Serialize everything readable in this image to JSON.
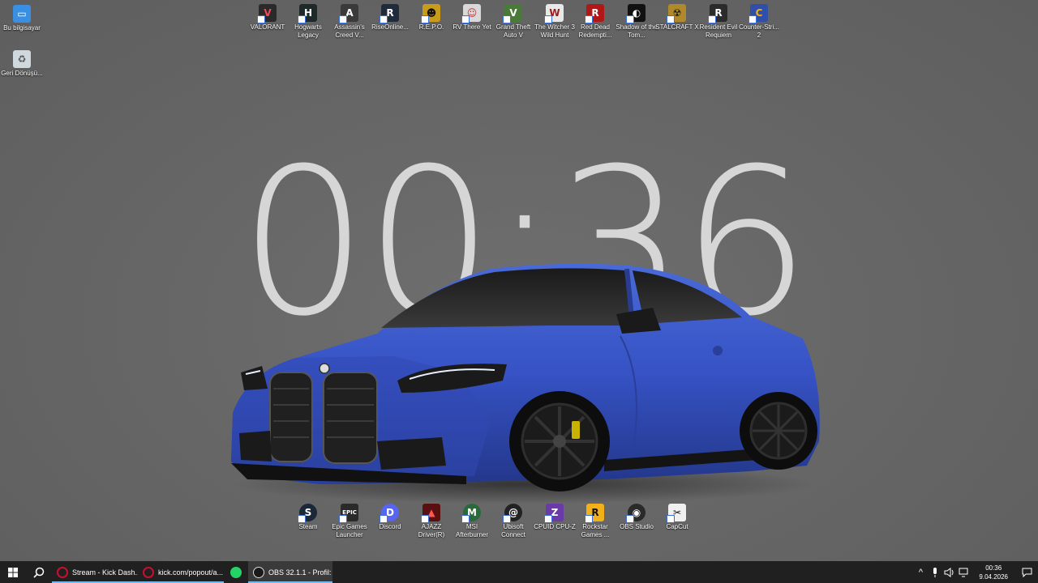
{
  "wallpaper": {
    "clock_text": "00:36"
  },
  "desktop_left": [
    {
      "label": "Bu bilgisayar",
      "icon": "this-pc-icon",
      "color": "#3b8fe0"
    },
    {
      "label": "Geri Dönüşü...",
      "icon": "recycle-bin-icon",
      "color": "#cfd8dc"
    }
  ],
  "desktop_top": [
    {
      "label": "VALORANT",
      "icon": "valorant-icon",
      "color": "#2a2a2a",
      "glyph": "V"
    },
    {
      "label": "Hogwarts Legacy",
      "icon": "hogwarts-legacy-icon",
      "color": "#1e2a2a",
      "glyph": "H"
    },
    {
      "label": "Assassin's Creed V...",
      "icon": "assassins-creed-icon",
      "color": "#3a3a3a",
      "glyph": "A"
    },
    {
      "label": "RiseOnline...",
      "icon": "rise-online-icon",
      "color": "#1f2a3a",
      "glyph": "R"
    },
    {
      "label": "R.E.P.O.",
      "icon": "repo-icon",
      "color": "#c89b1a",
      "glyph": "☻"
    },
    {
      "label": "RV There Yet",
      "icon": "rv-there-yet-icon",
      "color": "#d9d9d9",
      "glyph": "☺"
    },
    {
      "label": "Grand Theft Auto V",
      "icon": "gta-v-icon",
      "color": "#4a7a3a",
      "glyph": "V"
    },
    {
      "label": "The Witcher 3 Wild Hunt",
      "icon": "witcher-3-icon",
      "color": "#e8e8e8",
      "glyph": "W"
    },
    {
      "label": "Red Dead Redempti...",
      "icon": "red-dead-icon",
      "color": "#b01818",
      "glyph": "R"
    },
    {
      "label": "Shadow of the Tom...",
      "icon": "shadow-tomb-raider-icon",
      "color": "#111111",
      "glyph": "◐"
    },
    {
      "label": "STALCRAFT X",
      "icon": "stalcraft-icon",
      "color": "#b08a2a",
      "glyph": "☢"
    },
    {
      "label": "Resident Evil Requiem",
      "icon": "resident-evil-icon",
      "color": "#2b2b2b",
      "glyph": "R"
    },
    {
      "label": "Counter-Stri... 2",
      "icon": "counter-strike-icon",
      "color": "#2f4fa8",
      "glyph": "C"
    }
  ],
  "desktop_bottom": [
    {
      "label": "Steam",
      "icon": "steam-icon",
      "color": "#1b2838",
      "glyph": "S"
    },
    {
      "label": "Epic Games Launcher",
      "icon": "epic-games-icon",
      "color": "#2a2a2a",
      "glyph": "E"
    },
    {
      "label": "Discord",
      "icon": "discord-icon",
      "color": "#5865f2",
      "glyph": "D"
    },
    {
      "label": "AJAZZ Driver(R)",
      "icon": "ajazz-icon",
      "color": "#5a1010",
      "glyph": "A"
    },
    {
      "label": "MSI Afterburner",
      "icon": "msi-afterburner-icon",
      "color": "#2a6a3a",
      "glyph": "M"
    },
    {
      "label": "Ubisoft Connect",
      "icon": "ubisoft-icon",
      "color": "#222222",
      "glyph": "@"
    },
    {
      "label": "CPUID CPU-Z",
      "icon": "cpuz-icon",
      "color": "#6a3aa8",
      "glyph": "Z"
    },
    {
      "label": "Rockstar Games ...",
      "icon": "rockstar-icon",
      "color": "#f2b01a",
      "glyph": "R"
    },
    {
      "label": "OBS Studio",
      "icon": "obs-icon",
      "color": "#2a2a2a",
      "glyph": "◉"
    },
    {
      "label": "CapCut",
      "icon": "capcut-icon",
      "color": "#f0f0f0",
      "glyph": "✂"
    }
  ],
  "taskbar": {
    "tasks": [
      {
        "label": "Stream - Kick Dash...",
        "icon": "opera-gx-icon",
        "color": "#c8102e"
      },
      {
        "label": "kick.com/popout/a...",
        "icon": "opera-gx-icon",
        "color": "#c8102e"
      },
      {
        "label": "",
        "icon": "whatsapp-icon",
        "color": "#25d366"
      },
      {
        "label": "OBS 32.1.1 - Profil: l...",
        "icon": "obs-icon",
        "color": "#1a1a1a"
      }
    ],
    "time": "00:36",
    "date": "9.04.2026"
  }
}
